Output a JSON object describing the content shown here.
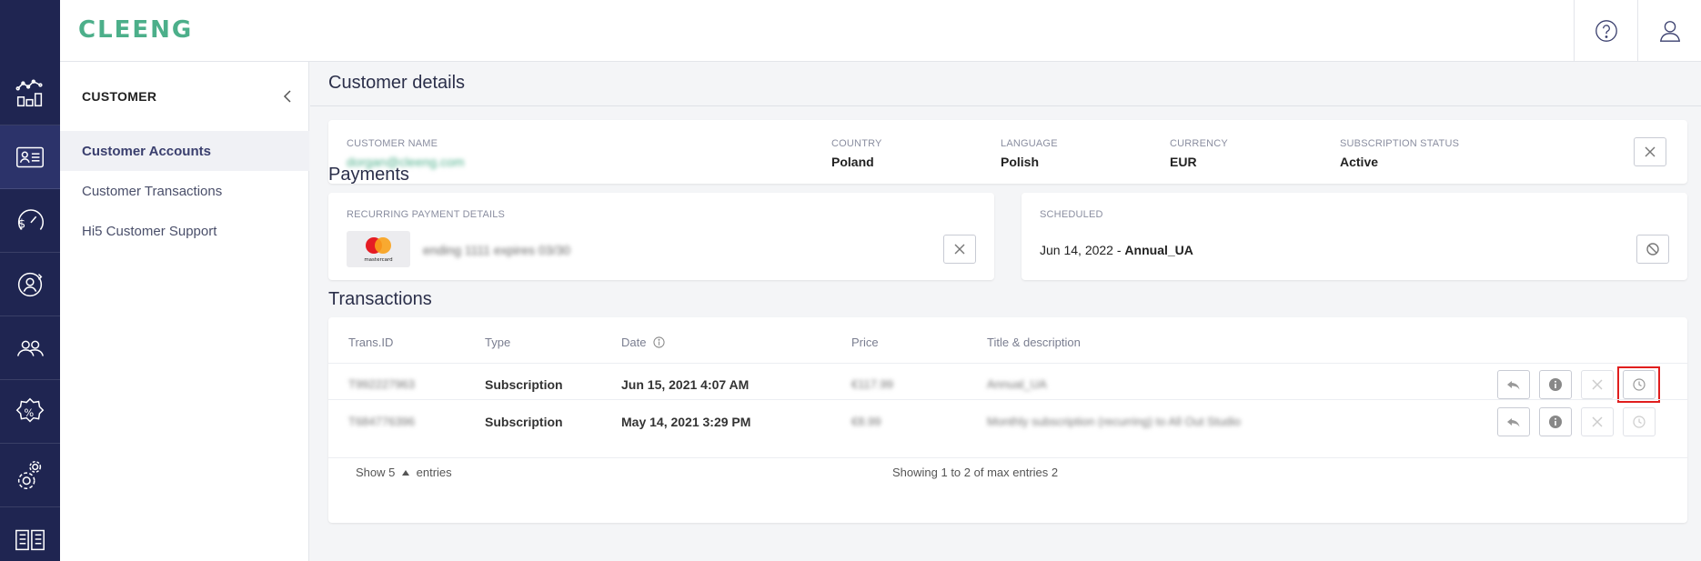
{
  "brand": {
    "logo_text": "CLEENG",
    "accent": "#4caf8a",
    "rail_bg": "#1f2551"
  },
  "rail": [
    "analytics-icon",
    "customer-card-icon",
    "revenue-gauge-icon",
    "customer-cycle-icon",
    "users-icon",
    "discount-icon",
    "settings-icon",
    "docs-icon"
  ],
  "sidebar": {
    "title": "CUSTOMER",
    "items": [
      {
        "label": "Customer Accounts"
      },
      {
        "label": "Customer Transactions"
      },
      {
        "label": "Hi5 Customer Support"
      }
    ]
  },
  "page": {
    "title": "Customer details"
  },
  "customer": {
    "name_label": "CUSTOMER NAME",
    "name_value": "dorgan@cleeng.com",
    "country_label": "COUNTRY",
    "country_value": "Poland",
    "language_label": "LANGUAGE",
    "language_value": "Polish",
    "currency_label": "CURRENCY",
    "currency_value": "EUR",
    "status_label": "SUBSCRIPTION STATUS",
    "status_value": "Active"
  },
  "payments": {
    "title": "Payments",
    "recurring_label": "RECURRING PAYMENT DETAILS",
    "card_brand": "mastercard",
    "card_details": "ending 1111 expires 03/30",
    "scheduled_label": "SCHEDULED",
    "scheduled_date": "Jun 14, 2022",
    "scheduled_sep": " - ",
    "scheduled_plan": "Annual_UA"
  },
  "transactions": {
    "title": "Transactions",
    "columns": {
      "id": "Trans.ID",
      "type": "Type",
      "date": "Date",
      "price": "Price",
      "title": "Title & description"
    },
    "rows": [
      {
        "id": "T992227963",
        "type": "Subscription",
        "date": "Jun 15, 2021 4:07 AM",
        "price": "€117.99",
        "title": "Annual_UA"
      },
      {
        "id": "T684776396",
        "type": "Subscription",
        "date": "May 14, 2021 3:29 PM",
        "price": "€8.99",
        "title": "Monthly subscription (recurring) to All Out Studio"
      }
    ],
    "footer": {
      "show": "Show 5",
      "entries": "entries",
      "summary": "Showing 1 to 2 of max entries 2"
    }
  }
}
